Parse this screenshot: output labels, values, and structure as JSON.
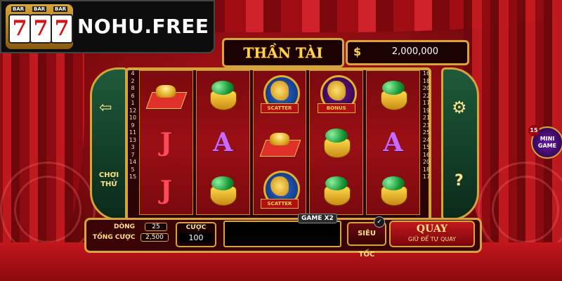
{
  "brand": {
    "logo_text": "NOHU.FREE",
    "reel_digits": [
      "7",
      "7",
      "7"
    ],
    "bar_tag": "BAR"
  },
  "game": {
    "title": "THẦN TÀI"
  },
  "balance": {
    "currency_icon": "$",
    "value": "2,000,000"
  },
  "paylines": {
    "left": [
      "4",
      "2",
      "8",
      "6",
      "1",
      "12",
      "10",
      "9",
      "11",
      "13",
      "3",
      "7",
      "14",
      "5",
      "15"
    ],
    "right": [
      "16",
      "18",
      "20",
      "22",
      "17",
      "19",
      "21",
      "23",
      "25",
      "24",
      "15",
      "16",
      "20",
      "18",
      "17"
    ]
  },
  "reels": [
    [
      "ingot",
      "J",
      "J"
    ],
    [
      "pot",
      "A",
      "pot"
    ],
    [
      "scatter",
      "ingot",
      "scatter"
    ],
    [
      "bonus",
      "pot",
      "pot"
    ],
    [
      "pot",
      "A",
      "pot"
    ]
  ],
  "symbol_labels": {
    "scatter": "SCATTER",
    "bonus": "BONUS"
  },
  "side_left": {
    "back_icon": "back-arrow-icon",
    "try_label": "CHƠI THỬ"
  },
  "side_right": {
    "settings_icon": "gear-icon",
    "help_label": "?"
  },
  "mini_game": {
    "count": "15",
    "label": "MINI GAME"
  },
  "controls": {
    "lines_label": "DÒNG",
    "lines_value": "25",
    "total_bet_label": "TỔNG CƯỢC",
    "total_bet_value": "2,500",
    "bet_label": "CƯỢC",
    "bet_value": "100",
    "game_x2_label": "GAME X2",
    "turbo_label": "SIÊU TỐC",
    "spin_label": "QUAY",
    "spin_sub": "GIỮ ĐỂ TỰ QUAY"
  },
  "colors": {
    "gold": "#d6a43a",
    "curtain_red": "#c21a20",
    "side_green": "#1e5a3a"
  }
}
